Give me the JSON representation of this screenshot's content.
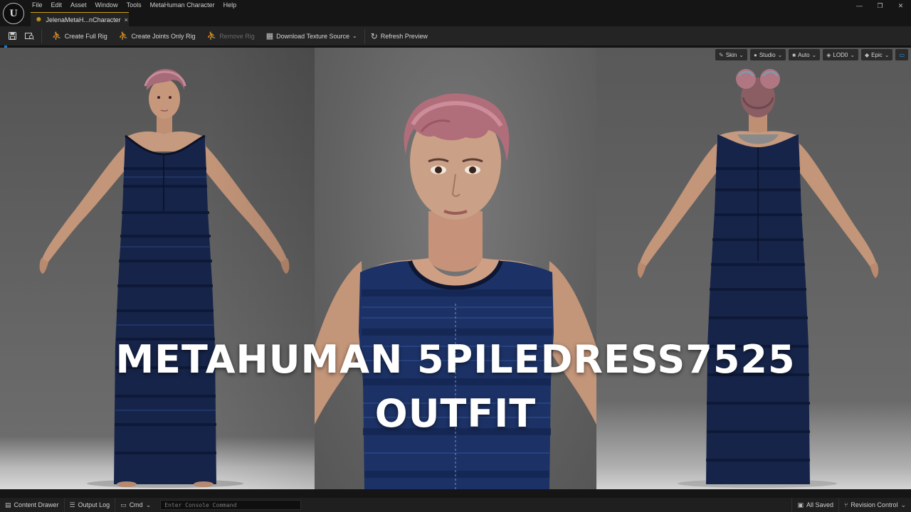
{
  "app": {
    "logo_text": "U",
    "menus": [
      "File",
      "Edit",
      "Asset",
      "Window",
      "Tools",
      "MetaHuman Character",
      "Help"
    ],
    "window_controls": [
      "—",
      "❐",
      "✕"
    ]
  },
  "tab": {
    "label": "JelenaMetaH...nCharacter",
    "close": "×"
  },
  "toolbar": {
    "create_full_rig": "Create Full Rig",
    "create_joints_only_rig": "Create Joints Only Rig",
    "remove_rig": "Remove Rig",
    "download_texture_source": "Download Texture Source",
    "refresh_preview": "Refresh Preview"
  },
  "viewport_toolbar": {
    "skin": "Skin",
    "studio": "Studio",
    "auto": "Auto",
    "lod": "LOD0",
    "quality": "Epic"
  },
  "overlay": {
    "line1": "METAHUMAN 5PILEDRESS7525",
    "line2": "OUTFIT"
  },
  "statusbar": {
    "content_drawer": "Content Drawer",
    "output_log": "Output Log",
    "cmd": "Cmd",
    "console_placeholder": "Enter Console Command",
    "all_saved": "All Saved",
    "revision_control": "Revision Control"
  },
  "colors": {
    "accent_gold": "#d0a012",
    "accent_blue": "#1a7bd0",
    "dress_blue": "#16244a"
  }
}
